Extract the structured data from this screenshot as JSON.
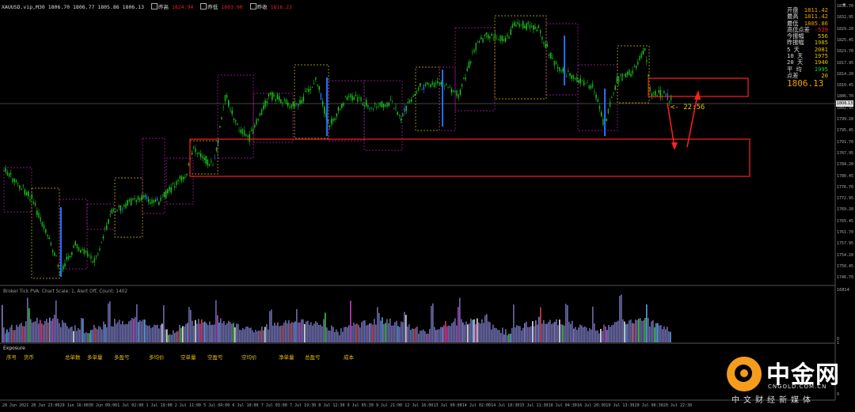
{
  "header": {
    "symbol_line": "XAUUSD.vip,M30  1806.70 1806.77 1805.86 1806.13",
    "buttons": [
      "昨高",
      "昨低",
      "昨收"
    ],
    "values": [
      "1824.94",
      "1803.00",
      "1816.22"
    ]
  },
  "info_panel": {
    "rows": [
      {
        "label": "开盘",
        "value": "1811.42",
        "color": "o"
      },
      {
        "label": "最高",
        "value": "1811.42",
        "color": "o"
      },
      {
        "label": "最低",
        "value": "1805.86",
        "color": "o"
      },
      {
        "label": "高低点差",
        "value": "-529",
        "color": "red"
      },
      {
        "label": "今振幅",
        "value": "556",
        "color": "y"
      },
      {
        "label": "昨振幅",
        "value": "1985",
        "color": "y"
      },
      {
        "label": "5  天",
        "value": "2081",
        "color": "y"
      },
      {
        "label": "10 天",
        "value": "1975",
        "color": "y"
      },
      {
        "label": "20 天",
        "value": "1940",
        "color": "y"
      },
      {
        "label": "平  均",
        "value": "1995",
        "color": "g"
      },
      {
        "label": "点差",
        "value": "20",
        "color": "y"
      }
    ],
    "current_price": "1806.13"
  },
  "countdown": "<- 22:56",
  "price_axis": [
    "1836.70",
    "1832.95",
    "1829.20",
    "1825.45",
    "1821.70",
    "1817.95",
    "1814.20",
    "1810.45",
    "1806.70",
    "1802.95",
    "1799.20",
    "1795.45",
    "1791.70",
    "1787.95",
    "1784.20",
    "1780.45",
    "1776.70",
    "1772.95",
    "1769.20",
    "1765.45",
    "1761.70",
    "1757.95",
    "1754.20",
    "1750.45",
    "1746.70"
  ],
  "current_price_label": "1806.13",
  "indicator": {
    "header": "Broker Tick PVA:  Chart Scale: 1, Alert Off, Count: 1402",
    "max_label": "16814",
    "zero_label": "0"
  },
  "exposure": {
    "title": "Exposure",
    "columns": [
      "序号",
      "货币",
      "总单数",
      "多单量",
      "多盈亏",
      "多均价",
      "空单量",
      "空盈亏",
      "空均价",
      "净单量",
      "总盈亏",
      "成本"
    ],
    "right_top": "1",
    "right_bottom": "0"
  },
  "time_axis": [
    "28 Jun 2021",
    "28 Jun 23:00",
    "29 Jun 16:00",
    "30 Jun 09:00",
    "1 Jul 02:00",
    "1 Jul 19:00",
    "2 Jul 11:00",
    "5 Jul 04:00",
    "6 Jul 10:00",
    "7 Jul 03:00",
    "7 Jul 19:30",
    "8 Jul 12:30",
    "9 Jul 05:30",
    "9 Jul 21:00",
    "12 Jul 16:00",
    "13 Jul 09:00",
    "14 Jul 02:00",
    "14 Jul 18:30",
    "15 Jul 11:30",
    "16 Jul 04:30",
    "16 Jul 20:30",
    "19 Jul 13:30",
    "20 Jul 06:30",
    "20 Jul 22:30"
  ],
  "logo": {
    "cn": "中金网",
    "en": "CNGOLD.COM.CN",
    "slogan": "中文财经新媒体"
  },
  "colors": {
    "bull": "#1fd11f",
    "bear": "#1f6fff",
    "box": "#b020b0",
    "box_yellow": "#d0c000",
    "annotation": "#ff2020"
  }
}
